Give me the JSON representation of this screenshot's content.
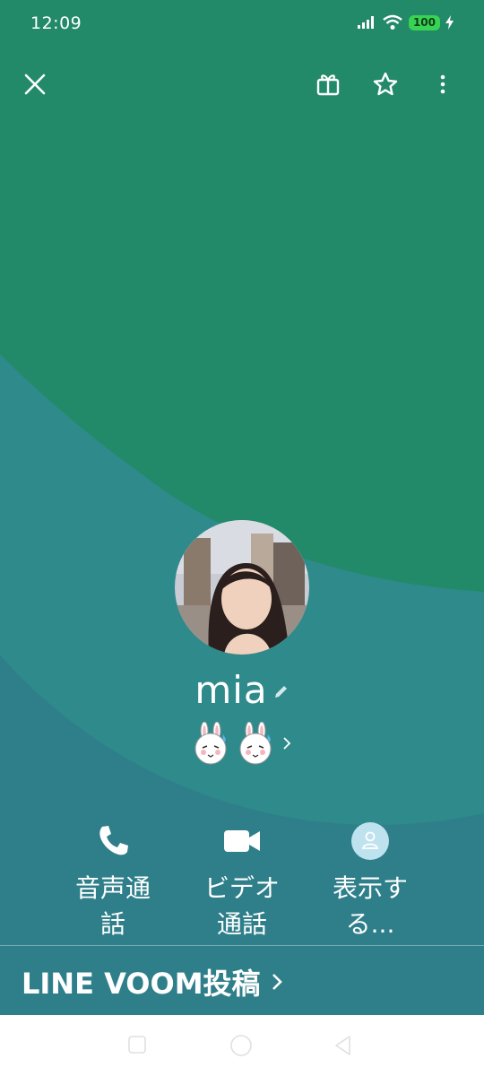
{
  "status_bar": {
    "time": "12:09",
    "battery": "100"
  },
  "colors": {
    "top_green": "#228a68",
    "teal": "#2f8a8c",
    "bottom_teal": "#2f7f8a"
  },
  "profile": {
    "name": "mia",
    "stickers": [
      "bunny-sticker",
      "bunny-sticker"
    ]
  },
  "actions": [
    {
      "icon": "phone-icon",
      "label_line1": "音声通",
      "label_line2": "話"
    },
    {
      "icon": "video-camera-icon",
      "label_line1": "ビデオ",
      "label_line2": "通話"
    },
    {
      "icon": "person-icon",
      "label_line1": "表示す",
      "label_line2": "る..."
    }
  ],
  "voom": {
    "label": "LINE VOOM投稿"
  }
}
